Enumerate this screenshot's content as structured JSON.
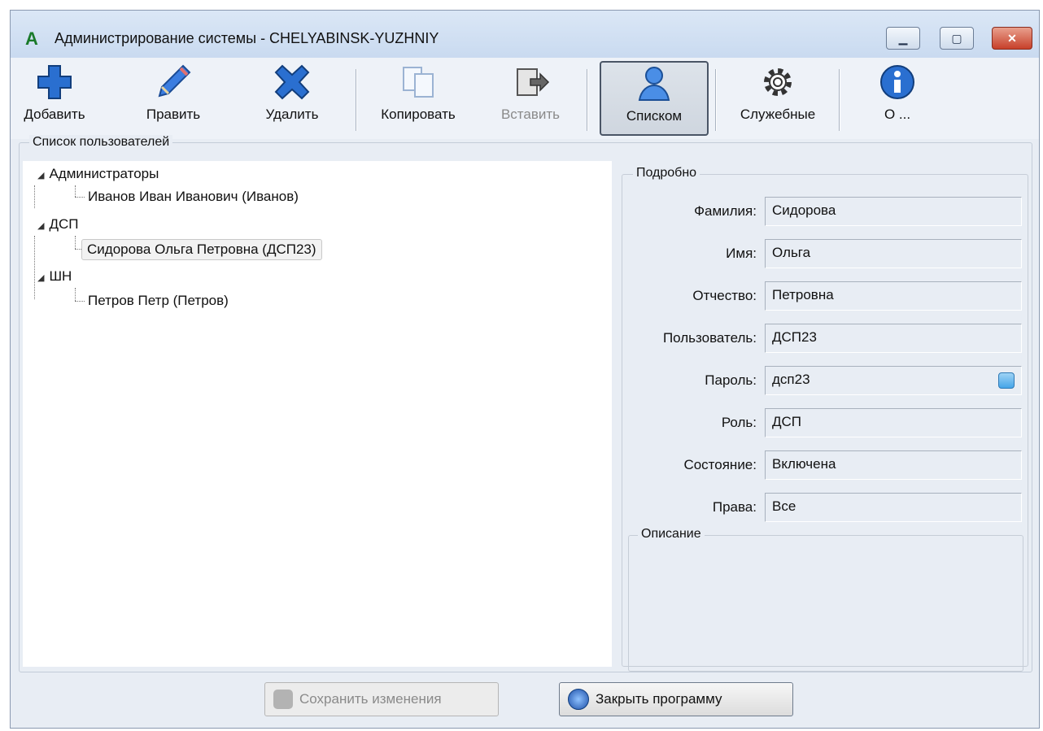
{
  "window": {
    "title": "Администрирование системы - CHELYABINSK-YUZHNIY",
    "icon_text": "A"
  },
  "toolbar": {
    "add": "Добавить",
    "edit": "Править",
    "delete": "Удалить",
    "copy": "Копировать",
    "paste": "Вставить",
    "list": "Списком",
    "service": "Служебные",
    "about": "О ..."
  },
  "users": {
    "caption": "Список пользователей",
    "groups": [
      {
        "name": "Администраторы",
        "members": [
          "Иванов Иван Иванович (Иванов)"
        ]
      },
      {
        "name": "ДСП",
        "members": [
          "Сидорова Ольга Петровна (ДСП23)"
        ]
      },
      {
        "name": "ШН",
        "members": [
          "Петров Петр (Петров)"
        ]
      }
    ]
  },
  "details": {
    "caption": "Подробно",
    "fields": [
      {
        "label": "Фамилия:",
        "value": "Сидорова"
      },
      {
        "label": "Имя:",
        "value": "Ольга"
      },
      {
        "label": "Отчество:",
        "value": "Петровна"
      },
      {
        "label": "Пользователь:",
        "value": "ДСП23"
      },
      {
        "label": "Пароль:",
        "value": "дсп23"
      },
      {
        "label": "Роль:",
        "value": "ДСП"
      },
      {
        "label": "Состояние:",
        "value": "Включена"
      },
      {
        "label": "Права:",
        "value": "Все"
      }
    ],
    "description_caption": "Описание"
  },
  "bottom": {
    "save": "Сохранить изменения",
    "close": "Закрыть программу"
  }
}
